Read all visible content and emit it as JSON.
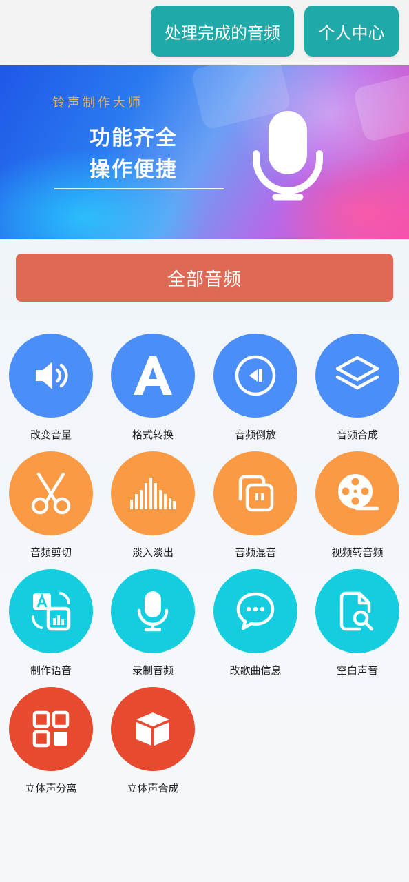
{
  "header": {
    "processed_button": "处理完成的音频",
    "profile_button": "个人中心"
  },
  "banner": {
    "tag": "铃声制作大师",
    "line1": "功能齐全",
    "line2": "操作便捷",
    "icon": "microphone-icon"
  },
  "all_audio_button": "全部音频",
  "colors": {
    "header_button": "#1fa9a8",
    "all_audio_button": "#de6a56",
    "row1": "#4b8ef8",
    "row2": "#fa9a44",
    "row3": "#14cee0",
    "row4": "#e74a2f"
  },
  "features": [
    {
      "label": "改变音量",
      "icon": "volume-icon"
    },
    {
      "label": "格式转换",
      "icon": "letter-a-icon"
    },
    {
      "label": "音频倒放",
      "icon": "rewind-icon"
    },
    {
      "label": "音频合成",
      "icon": "layers-icon"
    },
    {
      "label": "音频剪切",
      "icon": "scissors-icon"
    },
    {
      "label": "淡入淡出",
      "icon": "waveform-icon"
    },
    {
      "label": "音频混音",
      "icon": "mix-icon"
    },
    {
      "label": "视频转音频",
      "icon": "film-reel-icon"
    },
    {
      "label": "制作语音",
      "icon": "text-to-speech-icon"
    },
    {
      "label": "录制音频",
      "icon": "microphone-icon"
    },
    {
      "label": "改歌曲信息",
      "icon": "chat-bubble-icon"
    },
    {
      "label": "空白声音",
      "icon": "file-search-icon"
    },
    {
      "label": "立体声分离",
      "icon": "grid-icon"
    },
    {
      "label": "立体声合成",
      "icon": "cube-icon"
    }
  ]
}
